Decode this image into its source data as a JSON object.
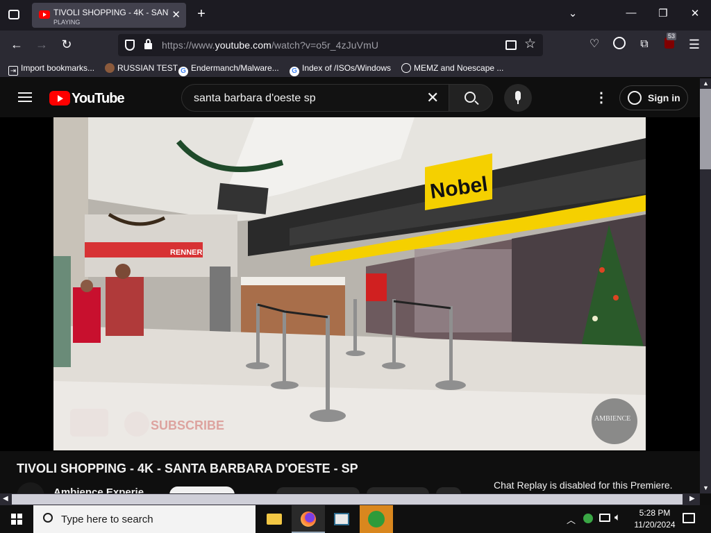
{
  "browser": {
    "tab": {
      "title": "TIVOLI SHOPPING - 4K - SANTA BARBARA D'OESTE - SP",
      "status": "PLAYING"
    },
    "url_prefix": "https://www.",
    "url_domain": "youtube.com",
    "url_path": "/watch?v=o5r_4zJuVmU",
    "extension_badge": "53",
    "bookmarks": [
      {
        "label": "Import bookmarks..."
      },
      {
        "label": "RUSSIAN TEST"
      },
      {
        "label": "Endermanch/Malware..."
      },
      {
        "label": "Index of /ISOs/Windows"
      },
      {
        "label": "MEMZ and Noescape ..."
      }
    ]
  },
  "youtube": {
    "logo_text": "YouTube",
    "search_value": "santa barbara d'oeste sp",
    "sign_in": "Sign in",
    "video": {
      "title": "TIVOLI SHOPPING - 4K - SANTA BARBARA D'OESTE - SP",
      "channel": "Ambience Experie",
      "store_sign": "Nobel",
      "store2_sign": "RENNER",
      "watermark": "AMBIENCE",
      "subscribe_overlay": "SUBSCRIBE"
    },
    "chat_replay": "Chat Replay is disabled for this Premiere."
  },
  "taskbar": {
    "search_placeholder": "Type here to search",
    "time": "5:28 PM",
    "date": "11/20/2024"
  },
  "colors": {
    "yt_red": "#ff0000",
    "nobel_yellow": "#f5d000"
  }
}
